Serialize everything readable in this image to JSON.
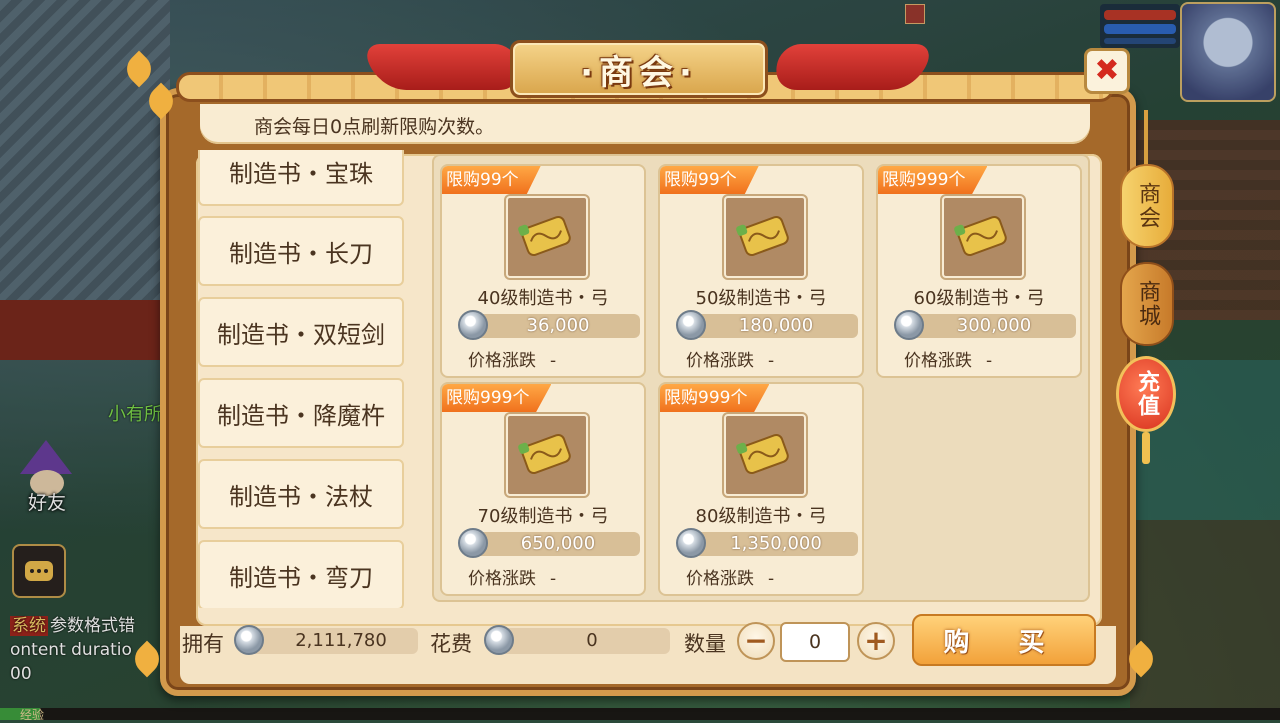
{
  "shop": {
    "title": "·商会·",
    "notice": "商会每日0点刷新限购次数。"
  },
  "categories": [
    {
      "label": "制造书・宝珠"
    },
    {
      "label": "制造书・长刀"
    },
    {
      "label": "制造书・双短剑"
    },
    {
      "label": "制造书・降魔杵"
    },
    {
      "label": "制造书・法杖"
    },
    {
      "label": "制造书・弯刀"
    }
  ],
  "goods": [
    {
      "limit": "限购99个",
      "name": "40级制造书・弓",
      "price": "36,000",
      "trend_label": "价格涨跌",
      "trend": "-"
    },
    {
      "limit": "限购99个",
      "name": "50级制造书・弓",
      "price": "180,000",
      "trend_label": "价格涨跌",
      "trend": "-"
    },
    {
      "limit": "限购999个",
      "name": "60级制造书・弓",
      "price": "300,000",
      "trend_label": "价格涨跌",
      "trend": "-"
    },
    {
      "limit": "限购999个",
      "name": "70级制造书・弓",
      "price": "650,000",
      "trend_label": "价格涨跌",
      "trend": "-"
    },
    {
      "limit": "限购999个",
      "name": "80级制造书・弓",
      "price": "1,350,000",
      "trend_label": "价格涨跌",
      "trend": "-"
    }
  ],
  "footer": {
    "own_label": "拥有",
    "own_value": "2,111,780",
    "cost_label": "花费",
    "cost_value": "0",
    "qty_label": "数量",
    "qty_value": "0",
    "minus": "−",
    "plus": "+",
    "buy_label": "购 买"
  },
  "side_tabs": {
    "shop": "商会",
    "mall": "商城",
    "recharge": "充值"
  },
  "background": {
    "friend_label": "好友",
    "npc_name": "小有所",
    "chat_lines": [
      "参数格式错",
      "ontent duratio",
      "00"
    ],
    "sys_tag": "系统",
    "exp_label": "经验"
  },
  "icons": {
    "close": "close-icon",
    "coin": "silver-coin-icon",
    "item": "scroll-icon",
    "chat": "chat-icon"
  },
  "colors": {
    "limit_tag": "#f0711d",
    "close": "#d42a1e",
    "panel_frame": "#a5692a",
    "buy_button": "#f2a23a"
  }
}
